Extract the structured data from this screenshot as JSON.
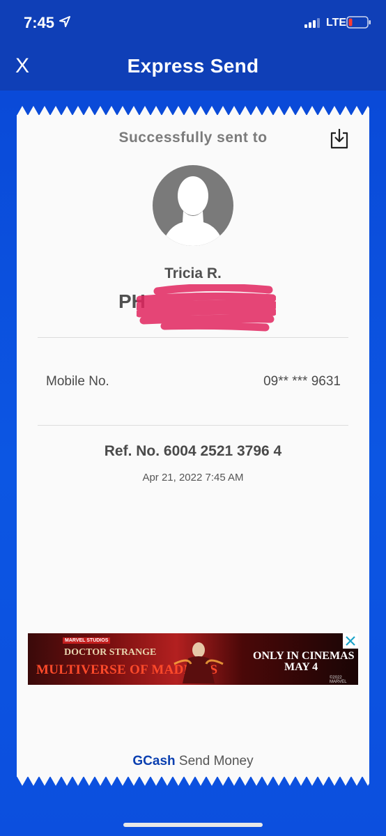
{
  "status_bar": {
    "time": "7:45",
    "network": "LTE",
    "icons": [
      "location-arrow-icon",
      "signal-bars-icon",
      "battery-low-icon"
    ]
  },
  "header": {
    "close_label": "X",
    "title": "Express Send"
  },
  "receipt": {
    "sent_to_label": "Successfully sent to",
    "download_icon": "download-icon",
    "avatar_icon": "default-avatar-icon",
    "recipient_name": "Tricia R.",
    "redacted_prefix": "PH",
    "mobile_label": "Mobile No.",
    "mobile_value": "09** *** 9631",
    "reference": "Ref. No. 6004 2521 3796 4",
    "date": "Apr 21, 2022 7:45 AM"
  },
  "ad": {
    "brand": "MARVEL STUDIOS",
    "title_line1": "DOCTOR STRANGE",
    "title_line2": "MULTIVERSE OF MADNESS",
    "tagline_line1": "ONLY IN CINEMAS",
    "tagline_line2": "MAY 4",
    "copyright": "©2022 MARVEL",
    "close_icon": "close-icon"
  },
  "footer": {
    "brand": "GCash",
    "label": "Send Money"
  },
  "colors": {
    "brand_blue": "#0f3fb7",
    "background_blue": "#0a49d6",
    "receipt_bg": "#fafafa",
    "redaction_pink": "#e0245e"
  }
}
